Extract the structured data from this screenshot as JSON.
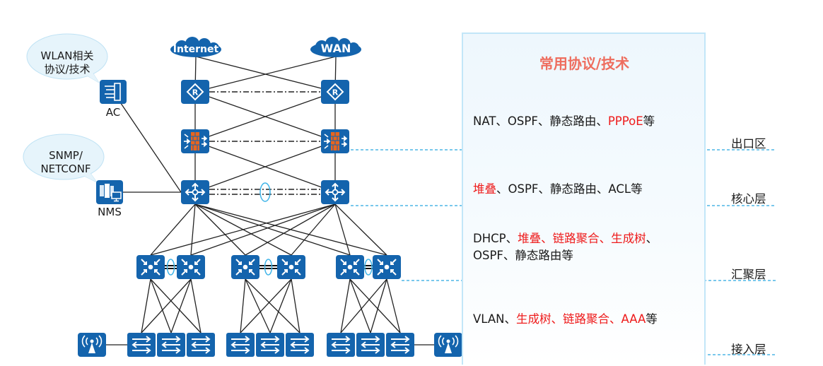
{
  "panel": {
    "title": "常用协议/技术"
  },
  "clouds": [
    {
      "id": "internet",
      "label": "Internet"
    },
    {
      "id": "wan",
      "label": "WAN"
    }
  ],
  "bubbles": [
    {
      "id": "wlan",
      "line1": "WLAN相关",
      "line2": "协议/技术"
    },
    {
      "id": "snmp",
      "line1": "SNMP/",
      "line2": "NETCONF"
    }
  ],
  "devices": {
    "ac_label": "AC",
    "nms_label": "NMS"
  },
  "layers": [
    {
      "name": "出口区",
      "protocols": [
        {
          "text": "NAT、OSPF、静态路由、",
          "highlight": false
        },
        {
          "text": "PPPoE",
          "highlight": true
        },
        {
          "text": "等",
          "highlight": false
        }
      ]
    },
    {
      "name": "核心层",
      "protocols": [
        {
          "text": "堆叠",
          "highlight": true
        },
        {
          "text": "、OSPF、静态路由、ACL等",
          "highlight": false
        }
      ]
    },
    {
      "name": "汇聚层",
      "protocols": [
        {
          "text": "DHCP、",
          "highlight": false
        },
        {
          "text": "堆叠、链路聚合、生成树",
          "highlight": true
        },
        {
          "text": "、",
          "highlight": false
        },
        {
          "text": "OSPF、静态路由等",
          "highlight": false,
          "newline": true
        }
      ]
    },
    {
      "name": "接入层",
      "protocols": [
        {
          "text": "VLAN、",
          "highlight": false
        },
        {
          "text": "生成树、链路聚合、AAA",
          "highlight": true
        },
        {
          "text": "等",
          "highlight": false
        }
      ]
    }
  ],
  "colors": {
    "device_blue": "#1464ad",
    "firewall_orange": "#e8651e",
    "dashed_line": "#29a8e0",
    "highlight_red": "#ee1c1c",
    "title_red": "#ee6d5e",
    "bubble_fill": "#e6f4fb",
    "stack_ring": "#3fb4e8"
  }
}
